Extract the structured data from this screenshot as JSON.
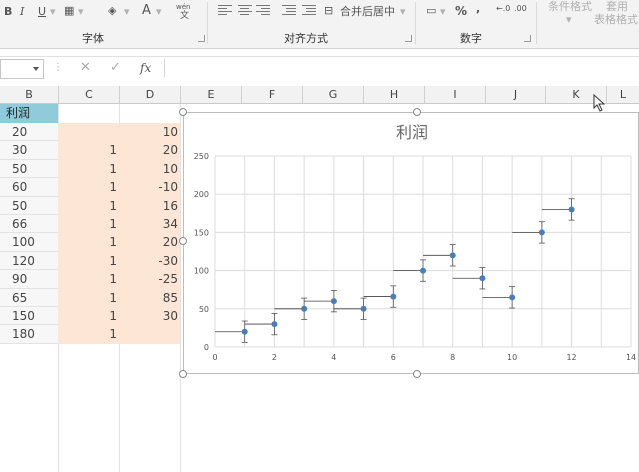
{
  "ribbon": {
    "font_buttons": {
      "bold": "B",
      "italic": "I",
      "underline": "U"
    },
    "wen": "wén",
    "wen2": "文",
    "font_label": "字体",
    "merge_label": "合并后居中",
    "align_label": "对齐方式",
    "percent": "%",
    "comma": ",",
    "dec_inc": "←.0",
    "dec_dec": ".00",
    "number_label": "数字",
    "cond_format": "条件格式",
    "table_format_1": "套用",
    "table_format_2": "表格格式"
  },
  "formula_bar": {
    "fx": "fx",
    "cancel": "✕",
    "confirm": "✓",
    "dots": "⋮"
  },
  "columns": [
    "B",
    "C",
    "D",
    "E",
    "F",
    "G",
    "H",
    "I",
    "J",
    "K",
    "L"
  ],
  "table": {
    "header": "利润",
    "col_b": [
      "20",
      "30",
      "50",
      "60",
      "50",
      "66",
      "100",
      "120",
      "90",
      "65",
      "150",
      "180"
    ],
    "col_c": [
      "",
      "1",
      "1",
      "1",
      "1",
      "1",
      "1",
      "1",
      "1",
      "1",
      "1",
      "1"
    ],
    "col_d": [
      "10",
      "20",
      "10",
      "-10",
      "16",
      "34",
      "20",
      "-30",
      "-25",
      "85",
      "30",
      ""
    ]
  },
  "chart_data": {
    "type": "scatter",
    "title": "利润",
    "x": [
      1,
      2,
      3,
      4,
      5,
      6,
      7,
      8,
      9,
      10,
      11,
      12
    ],
    "y": [
      20,
      30,
      50,
      60,
      50,
      66,
      100,
      120,
      90,
      65,
      150,
      180
    ],
    "step_left_length": 1,
    "error_bar_plus": [
      14,
      14,
      14,
      14,
      14,
      14,
      14,
      14,
      14,
      14,
      14,
      14
    ],
    "error_bar_minus": [
      14,
      14,
      14,
      14,
      14,
      14,
      14,
      14,
      14,
      14,
      14,
      14
    ],
    "xlim": [
      0,
      14
    ],
    "ylim": [
      0,
      250
    ],
    "x_ticks": [
      0,
      2,
      4,
      6,
      8,
      10,
      12,
      14
    ],
    "y_ticks": [
      0,
      50,
      100,
      150,
      200,
      250
    ],
    "grid": true,
    "colors": {
      "marker": "#4a7ebb",
      "line": "#404040",
      "error": "#555555",
      "grid": "#dcdcdc"
    }
  }
}
